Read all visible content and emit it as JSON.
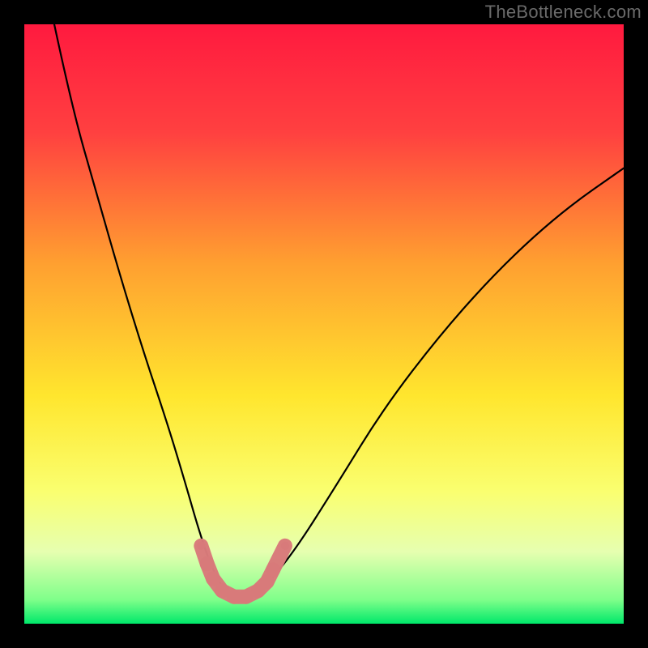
{
  "watermark": "TheBottleneck.com",
  "chart_data": {
    "type": "line",
    "title": "",
    "xlabel": "",
    "ylabel": "",
    "xlim": [
      0,
      100
    ],
    "ylim": [
      0,
      100
    ],
    "grid": false,
    "legend": false,
    "gradient_stops": [
      {
        "offset": 0,
        "color": "#ff1a3f"
      },
      {
        "offset": 18,
        "color": "#ff4040"
      },
      {
        "offset": 40,
        "color": "#ffa030"
      },
      {
        "offset": 62,
        "color": "#ffe62e"
      },
      {
        "offset": 78,
        "color": "#faff70"
      },
      {
        "offset": 88,
        "color": "#e6ffb0"
      },
      {
        "offset": 96,
        "color": "#7fff8a"
      },
      {
        "offset": 100,
        "color": "#00e86a"
      }
    ],
    "series": [
      {
        "name": "bottleneck-curve",
        "x": [
          5,
          8,
          12,
          16,
          20,
          24,
          27,
          29,
          31,
          33,
          35,
          37,
          40,
          45,
          52,
          60,
          70,
          80,
          90,
          100
        ],
        "values": [
          100,
          86,
          72,
          58,
          45,
          33,
          23,
          16,
          10,
          6,
          4,
          4,
          6,
          12,
          23,
          36,
          49,
          60,
          69,
          76
        ]
      }
    ],
    "markers": {
      "name": "highlight-segment",
      "color": "#d87a7a",
      "radius_small": 5,
      "radius_large": 9,
      "points": [
        {
          "x": 29.5,
          "y": 13,
          "r": "small"
        },
        {
          "x": 30.5,
          "y": 10,
          "r": "large"
        },
        {
          "x": 31.5,
          "y": 7.5,
          "r": "large"
        },
        {
          "x": 33,
          "y": 5.5,
          "r": "large"
        },
        {
          "x": 35,
          "y": 4.5,
          "r": "large"
        },
        {
          "x": 37,
          "y": 4.5,
          "r": "large"
        },
        {
          "x": 39,
          "y": 5.5,
          "r": "large"
        },
        {
          "x": 40.5,
          "y": 7,
          "r": "large"
        },
        {
          "x": 41.5,
          "y": 9,
          "r": "large"
        },
        {
          "x": 43.5,
          "y": 13,
          "r": "small"
        }
      ]
    }
  }
}
